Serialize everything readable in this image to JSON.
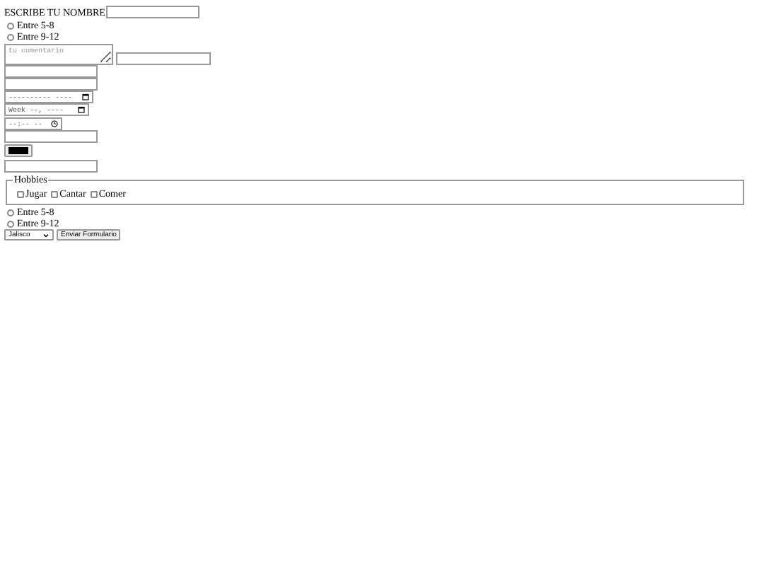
{
  "name_label": "ESCRIBE TU NOMBRE",
  "radios_top": [
    {
      "label": "Entre 5-8",
      "selected": false
    },
    {
      "label": "Entre 9-12",
      "selected": false
    }
  ],
  "comment": {
    "placeholder": "tu comentario"
  },
  "date_field": {
    "value": "---------- ----"
  },
  "week_field": {
    "value": "Week --, ----"
  },
  "time_field": {
    "value": "--:-- --"
  },
  "color_field": {
    "color": "#000000"
  },
  "hobbies": {
    "legend": "Hobbies",
    "items": [
      {
        "label": "Jugar",
        "checked": false
      },
      {
        "label": "Cantar",
        "checked": false
      },
      {
        "label": "Comer",
        "checked": false
      }
    ]
  },
  "radios_bottom": [
    {
      "label": "Entre 5-8",
      "selected": false
    },
    {
      "label": "Entre 9-12",
      "selected": false
    }
  ],
  "select": {
    "value": "Jalisco"
  },
  "submit": {
    "label": "Enviar Formulario"
  }
}
